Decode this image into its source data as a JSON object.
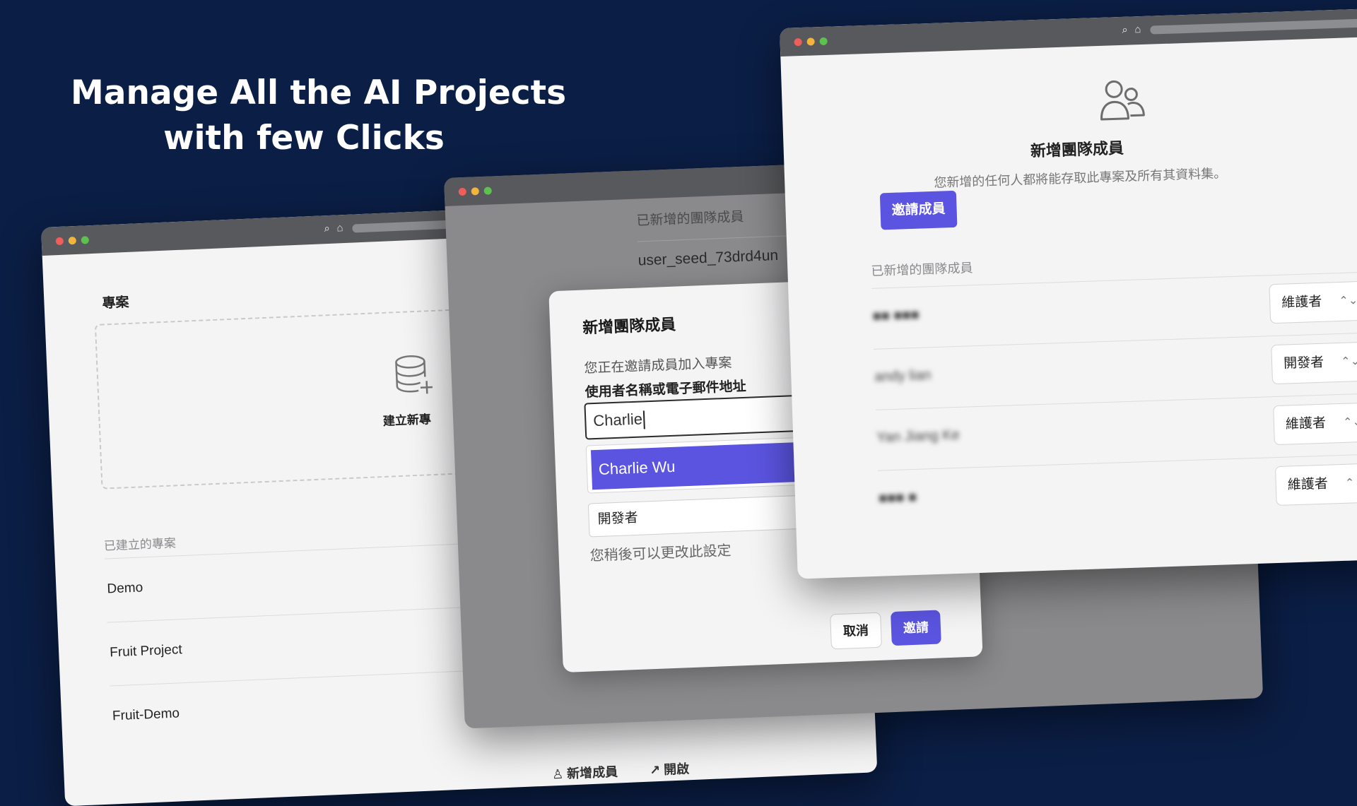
{
  "headline": {
    "line1": "Manage All the AI Projects",
    "line2": "with few Clicks"
  },
  "projects_window": {
    "section_title": "專案",
    "create_label": "建立新專",
    "created_label": "已建立的專案",
    "projects": [
      "Demo",
      "Fruit Project",
      "Fruit-Demo"
    ],
    "bottom_actions": {
      "add_member": "新增成員",
      "open": "開啟"
    }
  },
  "dialog_window": {
    "members_heading": "已新增的團隊成員",
    "seed_user": "user_seed_73drd4un",
    "dialog": {
      "title": "新增團隊成員",
      "description": "您正在邀請成員加入專案",
      "field_label": "使用者名稱或電子郵件地址",
      "input_value": "Charlie",
      "suggestion": "Charlie Wu",
      "role_value": "開發者",
      "role_hint": "您稍後可以更改此設定",
      "cancel_label": "取消",
      "invite_label": "邀請"
    }
  },
  "team_window": {
    "title": "新增團隊成員",
    "description": "您新增的任何人都將能存取此專案及所有其資料集。",
    "invite_button": "邀請成員",
    "added_label": "已新增的團隊成員",
    "members": [
      {
        "name": "■■ ■■■",
        "role": "維護者"
      },
      {
        "name": "andy lian",
        "role": "開發者"
      },
      {
        "name": "Yan Jiang Ke",
        "role": "維護者"
      },
      {
        "name": "■■■ ■",
        "role": "維護者"
      }
    ]
  },
  "colors": {
    "background": "#0b1e45",
    "accent": "#5b54e0",
    "titlebar": "#58595c"
  }
}
